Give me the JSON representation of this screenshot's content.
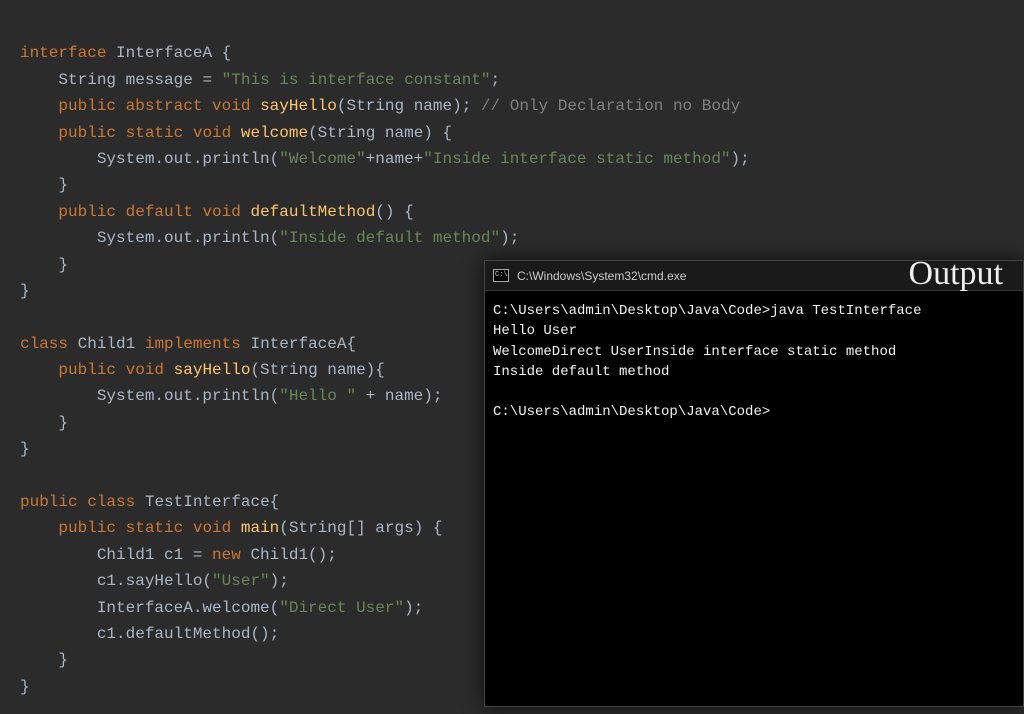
{
  "code": {
    "l1_kw_interface": "interface",
    "l1_cls": "InterfaceA",
    "l1_brace": "{",
    "l2_type": "String",
    "l2_ident": "message",
    "l2_eq": "=",
    "l2_str": "\"This is interface constant\"",
    "l2_semi": ";",
    "l3_kw_public": "public",
    "l3_kw_abstract": "abstract",
    "l3_kw_void": "void",
    "l3_method": "sayHello",
    "l3_params": "(String name)",
    "l3_semi": ";",
    "l3_comment": "// Only Declaration no Body",
    "l4_kw_public": "public",
    "l4_kw_static": "static",
    "l4_kw_void": "void",
    "l4_method": "welcome",
    "l4_params": "(String name) {",
    "l5_sys": "System.out.println(",
    "l5_str1": "\"Welcome\"",
    "l5_plus1": "+name+",
    "l5_str2": "\"Inside interface static method\"",
    "l5_end": ");",
    "l6_brace": "}",
    "l7_kw_public": "public",
    "l7_kw_default": "default",
    "l7_kw_void": "void",
    "l7_method": "defaultMethod",
    "l7_params": "() {",
    "l8_sys": "System.out.println(",
    "l8_str": "\"Inside default method\"",
    "l8_end": ");",
    "l9_brace": "}",
    "l10_brace": "}",
    "l12_kw_class": "class",
    "l12_cls": "Child1",
    "l12_kw_impl": "implements",
    "l12_iface": "InterfaceA",
    "l12_brace": "{",
    "l13_kw_public": "public",
    "l13_kw_void": "void",
    "l13_method": "sayHello",
    "l13_params": "(String name){",
    "l14_sys": "System.out.println(",
    "l14_str": "\"Hello \"",
    "l14_plus": " + name);",
    "l15_brace": "}",
    "l16_brace": "}",
    "l18_kw_public": "public",
    "l18_kw_class": "class",
    "l18_cls": "TestInterface",
    "l18_brace": "{",
    "l19_kw_public": "public",
    "l19_kw_static": "static",
    "l19_kw_void": "void",
    "l19_method": "main",
    "l19_params": "(String[] args) {",
    "l20_body": "Child1 c1 = ",
    "l20_kw_new": "new",
    "l20_ctor": " Child1();",
    "l21_body": "c1.sayHello(",
    "l21_str": "\"User\"",
    "l21_end": ");",
    "l22_body": "InterfaceA.welcome(",
    "l22_str": "\"Direct User\"",
    "l22_end": ");",
    "l23_body": "c1.defaultMethod();",
    "l24_brace": "}",
    "l25_brace": "}"
  },
  "cmd": {
    "title": "C:\\Windows\\System32\\cmd.exe",
    "output_label": "Output",
    "line1": "C:\\Users\\admin\\Desktop\\Java\\Code>java TestInterface",
    "line2": "Hello User",
    "line3": "WelcomeDirect UserInside interface static method",
    "line4": "Inside default method",
    "line5": "",
    "line6": "C:\\Users\\admin\\Desktop\\Java\\Code>"
  }
}
